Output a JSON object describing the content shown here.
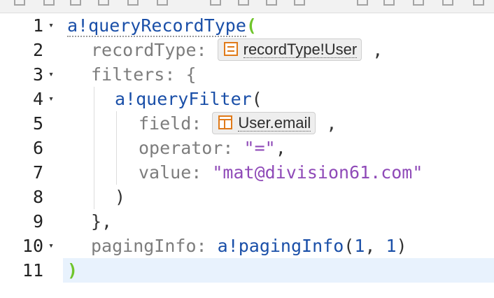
{
  "editor": {
    "lines": [
      {
        "num": "1",
        "fold": "▾"
      },
      {
        "num": "2",
        "fold": ""
      },
      {
        "num": "3",
        "fold": "▾"
      },
      {
        "num": "4",
        "fold": "▾"
      },
      {
        "num": "5",
        "fold": ""
      },
      {
        "num": "6",
        "fold": ""
      },
      {
        "num": "7",
        "fold": ""
      },
      {
        "num": "8",
        "fold": ""
      },
      {
        "num": "9",
        "fold": ""
      },
      {
        "num": "10",
        "fold": "▾"
      },
      {
        "num": "11",
        "fold": ""
      }
    ],
    "tokens": {
      "l1_fn": "a!queryRecordType",
      "l1_paren": "(",
      "l2_param": "recordType",
      "l2_colon": ": ",
      "l2_chip": "recordType!User",
      "l2_comma": " ,",
      "l3_param": "filters",
      "l3_rest": ": {",
      "l4_fn": "a!queryFilter",
      "l4_paren": "(",
      "l5_param": "field",
      "l5_colon": ": ",
      "l5_chip": "User.email",
      "l5_comma": " ,",
      "l6_param": "operator",
      "l6_colon": ": ",
      "l6_str": "\"=\"",
      "l6_comma": ",",
      "l7_param": "value",
      "l7_colon": ": ",
      "l7_str": "\"mat@division61.com\"",
      "l8_text": ")",
      "l9_text": "},",
      "l10_param": "pagingInfo",
      "l10_colon": ": ",
      "l10_fn": "a!pagingInfo",
      "l10_open": "(",
      "l10_n1": "1",
      "l10_sep": ", ",
      "l10_n2": "1",
      "l10_close": ")",
      "l11_paren": ")"
    }
  },
  "icons": {
    "record_chip": "record-type-icon",
    "field_chip": "record-field-icon"
  },
  "colors": {
    "function": "#1a4fa8",
    "parameter": "#7d7d7d",
    "string": "#8f4ab8",
    "matched_paren": "#6fc52b",
    "chip_icon": "#e07a19",
    "active_line": "#e8f2fd"
  }
}
